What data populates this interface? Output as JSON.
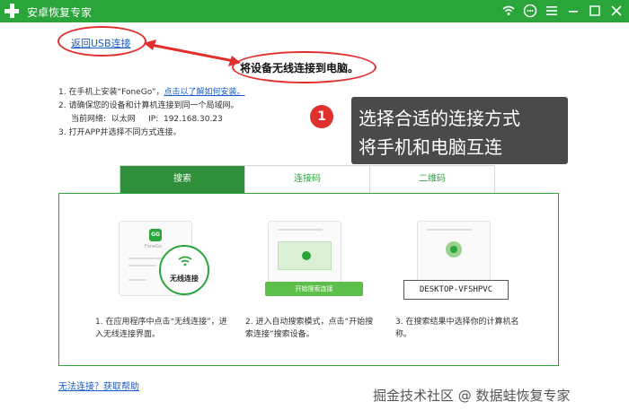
{
  "window": {
    "title": "安卓恢复专家"
  },
  "titlebar_icons": [
    "wifi-icon",
    "chat-icon",
    "menu-icon",
    "minimize-icon",
    "close-icon"
  ],
  "back_link": "返回USB连接",
  "heading": "将设备无线连接到电脑。",
  "steps": {
    "s1_prefix": "1.  在手机上安装“FoneGo”，",
    "s1_link": "点击以了解如何安装。",
    "s2": "2.  请确保您的设备和计算机连接到同一个局域网。",
    "net_label": "当前网络:",
    "net_value": "以太网",
    "ip_label": "IP:",
    "ip_value": "192.168.30.23",
    "s3": "3.  打开APP并选择不同方式连接。"
  },
  "callout": {
    "number": "1",
    "line1": "选择合适的连接方式",
    "line2": "将手机和电脑互连"
  },
  "tabs": [
    {
      "label": "搜索",
      "active": true
    },
    {
      "label": "连接码",
      "active": false
    },
    {
      "label": "二维码",
      "active": false
    }
  ],
  "cards": {
    "c1_logo": "GG",
    "c1_app": "FoneGo",
    "wifi_label": "无线连接",
    "search_button": "开始搜索连接",
    "device_name": "DESKTOP-VFSHPVC"
  },
  "descriptions": {
    "d1": "1.  在应用程序中点击“无线连接”，进入无线连接界面。",
    "d2": "2.  进入自动搜索模式，点击“开始搜索连接”搜索设备。",
    "d3": "3.  在搜索结果中选择你的计算机名称。"
  },
  "help_link": "无法连接？获取帮助",
  "watermark": "掘金技术社区 @ 数据蛙恢复专家",
  "colors": {
    "brand": "#2aa53a",
    "accent_red": "#e0302d",
    "link": "#1a5cc8",
    "callout_bg": "#4a4a4a"
  }
}
